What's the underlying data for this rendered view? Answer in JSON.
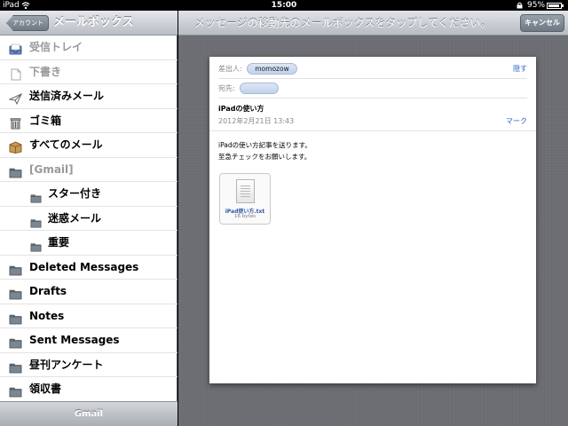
{
  "status_bar": {
    "carrier": "iPad",
    "time": "15:00",
    "battery": "95%"
  },
  "sidebar": {
    "back_label": "アカウント",
    "title": "メールボックス",
    "toolbar_label": "Gmail",
    "mailboxes": [
      {
        "label": "受信トレイ",
        "icon": "inbox-icon",
        "dim": true
      },
      {
        "label": "下書き",
        "icon": "drafts-icon",
        "dim": true
      },
      {
        "label": "送信済みメール",
        "icon": "sent-icon"
      },
      {
        "label": "ゴミ箱",
        "icon": "trash-icon"
      },
      {
        "label": "すべてのメール",
        "icon": "all-mail-box-icon"
      },
      {
        "label": "[Gmail]",
        "icon": "folder-icon",
        "dim": true
      },
      {
        "label": "スター付き",
        "icon": "folder-icon",
        "sub": true
      },
      {
        "label": "迷惑メール",
        "icon": "folder-icon",
        "sub": true
      },
      {
        "label": "重要",
        "icon": "folder-icon",
        "sub": true
      },
      {
        "label": "Deleted Messages",
        "icon": "folder-icon"
      },
      {
        "label": "Drafts",
        "icon": "folder-icon"
      },
      {
        "label": "Notes",
        "icon": "folder-icon"
      },
      {
        "label": "Sent Messages",
        "icon": "folder-icon"
      },
      {
        "label": "昼刊アンケート",
        "icon": "folder-icon"
      },
      {
        "label": "領収書",
        "icon": "folder-icon"
      }
    ]
  },
  "main": {
    "instruction": "メッセージの移動先のメールボックスをタップしてください。",
    "cancel_label": "キャンセル",
    "message": {
      "from_label": "差出人:",
      "from_value": "momozow",
      "hide_label": "隠す",
      "to_label": "宛先:",
      "subject": "iPadの使い方",
      "date": "2012年2月21日 13:43",
      "mark_label": "マーク",
      "body_line1": "iPadの使い方記事を送ります。",
      "body_line2": "至急チェックをお願いします。",
      "attachment_name": "iPad使い方.txt",
      "attachment_size": "16 bytes"
    }
  }
}
